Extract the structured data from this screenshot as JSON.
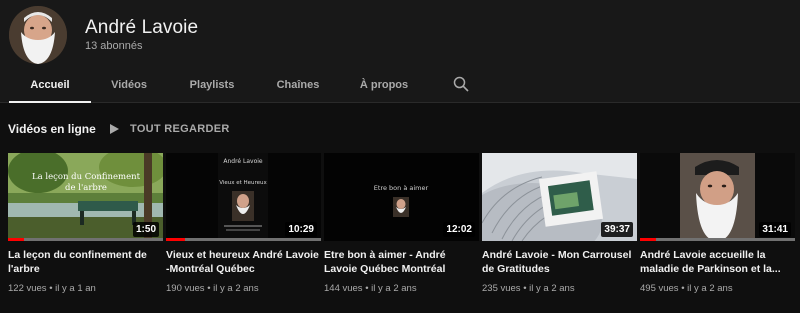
{
  "channel": {
    "name": "André Lavoie",
    "subscribers": "13 abonnés"
  },
  "tabs": [
    {
      "label": "Accueil",
      "active": true
    },
    {
      "label": "Vidéos",
      "active": false
    },
    {
      "label": "Playlists",
      "active": false
    },
    {
      "label": "Chaînes",
      "active": false
    },
    {
      "label": "À propos",
      "active": false
    }
  ],
  "section": {
    "title": "Vidéos en ligne",
    "play_all": "TOUT REGARDER"
  },
  "thumb_text": {
    "v1_line1": "La leçon du Confinement",
    "v1_line2": "de l'arbre",
    "v2_name": "André Lavoie",
    "v2_tagline": "Vieux et Heureux",
    "v3_caption": "Etre bon à aimer"
  },
  "videos": [
    {
      "title": "La leçon du confinement de l'arbre",
      "duration": "1:50",
      "views": "122 vues",
      "age": "il y a 1 an",
      "progress": 0.1
    },
    {
      "title": "Vieux et heureux André Lavoie -Montréal Québec",
      "duration": "10:29",
      "views": "190 vues",
      "age": "il y a 2 ans",
      "progress": 0.12
    },
    {
      "title": "Etre bon à aimer - André Lavoie Québec Montréal",
      "duration": "12:02",
      "views": "144 vues",
      "age": "il y a 2 ans",
      "progress": 0
    },
    {
      "title": "André Lavoie - Mon Carrousel de Gratitudes",
      "duration": "39:37",
      "views": "235 vues",
      "age": "il y a 2 ans",
      "progress": 0
    },
    {
      "title": "André Lavoie accueille la maladie de Parkinson et la...",
      "duration": "31:41",
      "views": "495 vues",
      "age": "il y a 2 ans",
      "progress": 0.1
    }
  ],
  "colors": {
    "background": "#0f0f0f",
    "header": "#181818",
    "progress": "#ff0000",
    "text": "#f1f1f1",
    "muted": "#aaaaaa"
  }
}
